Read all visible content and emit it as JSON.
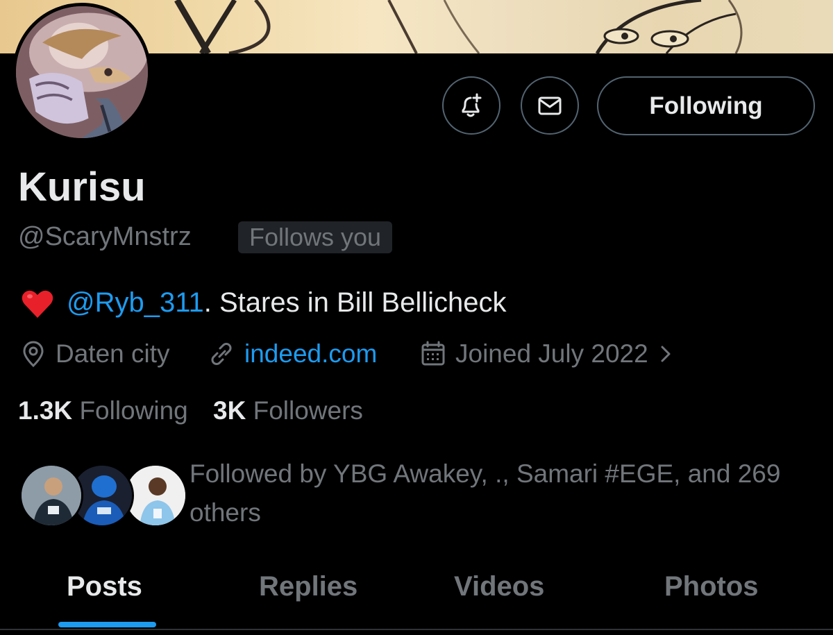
{
  "profile": {
    "name": "Kurisu",
    "handle": "@ScaryMnstrz",
    "follows_you": "Follows you",
    "bio": {
      "mention": "@Ryb_311",
      "text": ". Stares in Bill Bellicheck"
    },
    "location": "Daten city",
    "website": "indeed.com",
    "joined": "Joined July 2022",
    "following_count": "1.3K",
    "following_label": "Following",
    "followers_count": "3K",
    "followers_label": "Followers",
    "followed_by": "Followed by YBG Awakey, ., Samari #EGE, and 269 others"
  },
  "actions": {
    "notify_icon": "bell-plus-icon",
    "message_icon": "envelope-icon",
    "follow_label": "Following"
  },
  "tabs": [
    {
      "label": "Posts",
      "active": true
    },
    {
      "label": "Replies",
      "active": false
    },
    {
      "label": "Videos",
      "active": false
    },
    {
      "label": "Photos",
      "active": false
    }
  ],
  "colors": {
    "background": "#000000",
    "text": "#e7e9ea",
    "secondary": "#71767b",
    "accent": "#1d9bf0",
    "border": "#536471"
  }
}
